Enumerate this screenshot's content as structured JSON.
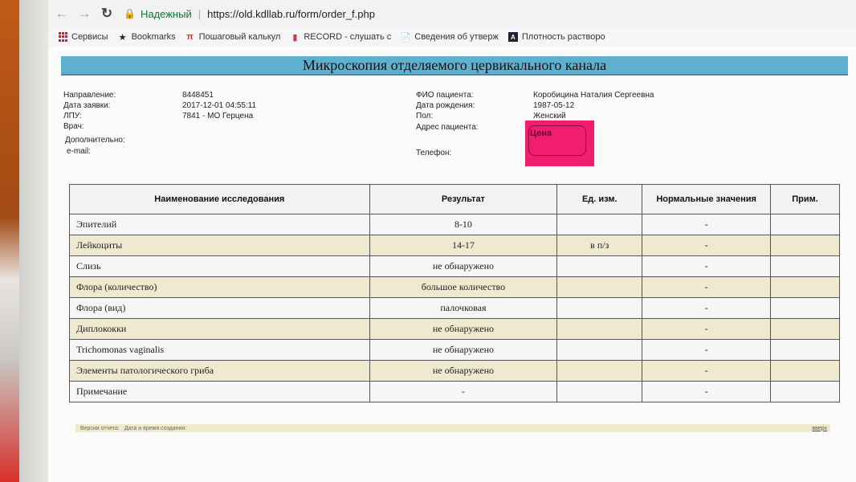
{
  "browser": {
    "secure_label": "Надежный",
    "url": "https://old.kdllab.ru/form/order_f.php",
    "bookmarks": [
      {
        "label": "Сервисы",
        "icon": "apps-icon"
      },
      {
        "label": "Bookmarks",
        "icon": "star-icon"
      },
      {
        "label": "Пошаговый калькул",
        "icon": "pi-icon"
      },
      {
        "label": "RECORD - слушать с",
        "icon": "chart-icon"
      },
      {
        "label": "Сведения об утверж",
        "icon": "document-icon"
      },
      {
        "label": "Плотность растворо",
        "icon": "aj-icon"
      }
    ]
  },
  "page": {
    "title": "Микроскопия отделяемого цервикального канала",
    "left_info": [
      {
        "label": "Направление:",
        "value": "8448451"
      },
      {
        "label": "Дата заявки:",
        "value": "2017-12-01 04:55:11"
      },
      {
        "label": "ЛПУ:",
        "value": "7841 - МО Герцена"
      },
      {
        "label": "Врач:",
        "value": ""
      },
      {
        "label": "Дополнительно:",
        "value": ""
      },
      {
        "label": "e-mail:",
        "value": ""
      }
    ],
    "right_info": [
      {
        "label": "ФИО пациента:",
        "value": "Коробицина Наталия Сергеевна"
      },
      {
        "label": "Дата рождения:",
        "value": "1987-05-12"
      },
      {
        "label": "Пол:",
        "value": "Женский"
      },
      {
        "label": "Адрес пациента:",
        "value": ""
      },
      {
        "label": "Телефон:",
        "value": ""
      }
    ],
    "price_sticker": "Цена"
  },
  "table": {
    "headers": [
      "Наименование исследования",
      "Результат",
      "Ед. изм.",
      "Нормальные значения",
      "Прим."
    ],
    "rows": [
      {
        "name": "Эпителий",
        "result": "8-10",
        "unit": "",
        "norm": "-",
        "note": ""
      },
      {
        "name": "Лейкоциты",
        "result": "14-17",
        "unit": "в п/з",
        "norm": "-",
        "note": ""
      },
      {
        "name": "Слизь",
        "result": "не обнаружено",
        "unit": "",
        "norm": "-",
        "note": ""
      },
      {
        "name": "Флора (количество)",
        "result": "большое количество",
        "unit": "",
        "norm": "-",
        "note": ""
      },
      {
        "name": "Флора (вид)",
        "result": "палочковая",
        "unit": "",
        "norm": "-",
        "note": ""
      },
      {
        "name": "Диплококки",
        "result": "не обнаружено",
        "unit": "",
        "norm": "-",
        "note": ""
      },
      {
        "name": "Trichomonas vaginalis",
        "result": "не обнаружено",
        "unit": "",
        "norm": "-",
        "note": ""
      },
      {
        "name": "Элементы патологического гриба",
        "result": "не обнаружено",
        "unit": "",
        "norm": "-",
        "note": ""
      },
      {
        "name": "Примечание",
        "result": "-",
        "unit": "",
        "norm": "-",
        "note": ""
      }
    ]
  },
  "footer": {
    "version_label": "Версия отчета:",
    "created_label": "Дата и время создания:",
    "up_link": "вверх"
  },
  "colors": {
    "title_bar": "#5fb0cf",
    "row_alt": "#efeacf",
    "sticker": "#f11d6e"
  }
}
